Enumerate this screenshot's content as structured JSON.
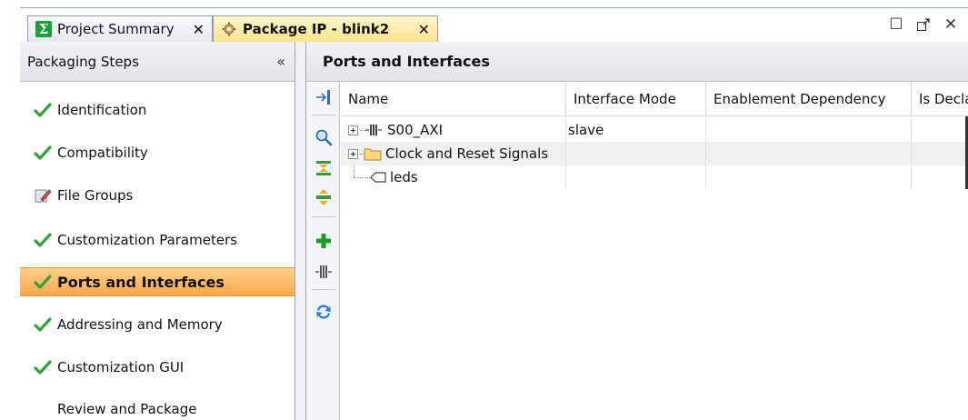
{
  "tabs": [
    {
      "label": "Project Summary",
      "icon": "sigma-icon",
      "close": "✕"
    },
    {
      "label": "Package IP - blink2",
      "icon": "gear-icon",
      "close": "✕"
    }
  ],
  "window_controls": {
    "maximize": "☐",
    "float": "⇗",
    "close": "✕"
  },
  "left_panel": {
    "title": "Packaging Steps",
    "collapse_glyph": "«",
    "steps": [
      {
        "label": "Identification",
        "icon": "checkmark-icon",
        "status": "done"
      },
      {
        "label": "Compatibility",
        "icon": "checkmark-icon",
        "status": "done"
      },
      {
        "label": "File Groups",
        "icon": "edit-pencil-icon",
        "status": "edited"
      },
      {
        "label": "Customization Parameters",
        "icon": "checkmark-icon",
        "status": "done"
      },
      {
        "label": "Ports and Interfaces",
        "icon": "checkmark-icon",
        "status": "done",
        "selected": true
      },
      {
        "label": "Addressing and Memory",
        "icon": "checkmark-icon",
        "status": "done"
      },
      {
        "label": "Customization GUI",
        "icon": "checkmark-icon",
        "status": "done"
      },
      {
        "label": "Review and Package",
        "icon": "none",
        "status": "pending"
      }
    ]
  },
  "main": {
    "title": "Ports and Interfaces",
    "toolbar": [
      "collapse-all-icon",
      "search-icon",
      "expand-all-icon",
      "filter-icon",
      "add-icon",
      "bus-interface-icon",
      "refresh-icon"
    ],
    "columns": [
      "Name",
      "Interface Mode",
      "Enablement Dependency",
      "Is Decla"
    ],
    "rows": [
      {
        "name": "S00_AXI",
        "icon": "bus-interface-icon",
        "expandable": true,
        "mode": "slave",
        "dependency": "",
        "declared": ""
      },
      {
        "name": "Clock and Reset Signals",
        "icon": "folder-icon",
        "expandable": true,
        "mode": "",
        "dependency": "",
        "declared": ""
      },
      {
        "name": "leds",
        "icon": "port-icon",
        "expandable": false,
        "mode": "",
        "dependency": "",
        "declared": ""
      }
    ]
  },
  "colors": {
    "active_step_bg": "#f7a94a",
    "active_tab_bg": "#ffe38c",
    "check_green": "#2ea43a",
    "header_bg": "#e1e4e8"
  }
}
